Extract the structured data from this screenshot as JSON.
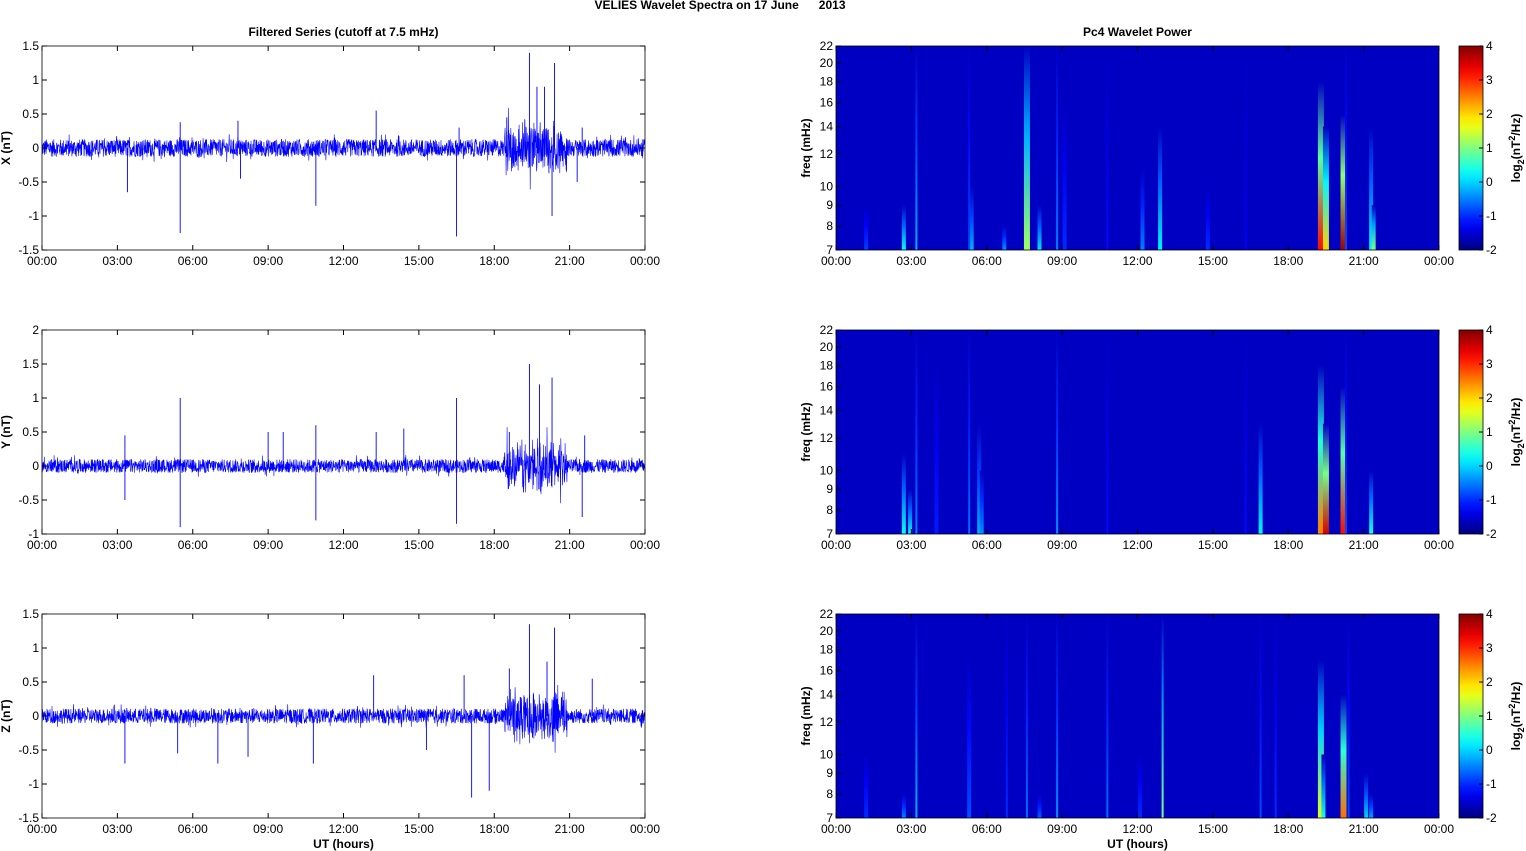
{
  "figure_title": "VELIES Wavelet Spectra on 17 June      2013",
  "chart_data": [
    {
      "type": "line",
      "panel": "X",
      "title": "Filtered Series (cutoff at 7.5 mHz)",
      "xlabel": "",
      "ylabel": "X (nT)",
      "ylim": [
        -1.5,
        1.5
      ],
      "yticks": [
        "-1.5",
        "-1",
        "-0.5",
        "0",
        "0.5",
        "1",
        "1.5"
      ],
      "xlim": [
        0,
        24
      ],
      "xticks": [
        "00:00",
        "03:00",
        "06:00",
        "09:00",
        "12:00",
        "15:00",
        "18:00",
        "21:00",
        "00:00"
      ],
      "color": "#0000ff",
      "noise_amplitude": 0.13,
      "active_interval_hours": [
        18.4,
        20.9
      ],
      "active_amplitude": 0.45,
      "spikes": [
        [
          3.4,
          -0.65
        ],
        [
          5.5,
          -1.25
        ],
        [
          5.5,
          0.38
        ],
        [
          7.8,
          0.4
        ],
        [
          7.9,
          -0.45
        ],
        [
          10.9,
          -0.85
        ],
        [
          13.3,
          0.55
        ],
        [
          16.5,
          -1.3
        ],
        [
          16.6,
          0.3
        ],
        [
          18.5,
          0.45
        ],
        [
          19.4,
          1.4
        ],
        [
          19.7,
          0.9
        ],
        [
          20.0,
          0.9
        ],
        [
          20.3,
          -1.0
        ],
        [
          20.4,
          1.25
        ],
        [
          21.3,
          -0.5
        ],
        [
          21.5,
          0.3
        ]
      ]
    },
    {
      "type": "line",
      "panel": "Y",
      "title": "",
      "xlabel": "",
      "ylabel": "Y (nT)",
      "ylim": [
        -1,
        2
      ],
      "yticks": [
        "-1",
        "-0.5",
        "0",
        "0.5",
        "1",
        "1.5",
        "2"
      ],
      "xlim": [
        0,
        24
      ],
      "xticks": [
        "00:00",
        "03:00",
        "06:00",
        "09:00",
        "12:00",
        "15:00",
        "18:00",
        "21:00",
        "00:00"
      ],
      "color": "#0000ff",
      "noise_amplitude": 0.1,
      "active_interval_hours": [
        18.4,
        20.9
      ],
      "active_amplitude": 0.45,
      "spikes": [
        [
          3.3,
          0.45
        ],
        [
          3.3,
          -0.5
        ],
        [
          5.5,
          1.0
        ],
        [
          5.5,
          -0.9
        ],
        [
          9.0,
          0.5
        ],
        [
          9.6,
          0.5
        ],
        [
          10.9,
          0.6
        ],
        [
          10.9,
          -0.8
        ],
        [
          13.3,
          0.5
        ],
        [
          14.4,
          0.55
        ],
        [
          16.5,
          1.0
        ],
        [
          16.5,
          -0.85
        ],
        [
          18.6,
          0.5
        ],
        [
          19.4,
          1.5
        ],
        [
          19.8,
          1.2
        ],
        [
          20.3,
          1.3
        ],
        [
          21.5,
          -0.75
        ],
        [
          21.6,
          0.45
        ]
      ]
    },
    {
      "type": "line",
      "panel": "Z",
      "title": "",
      "xlabel": "UT (hours)",
      "ylabel": "Z (nT)",
      "ylim": [
        -1.5,
        1.5
      ],
      "yticks": [
        "-1.5",
        "-1",
        "-0.5",
        "0",
        "0.5",
        "1",
        "1.5"
      ],
      "xlim": [
        0,
        24
      ],
      "xticks": [
        "00:00",
        "03:00",
        "06:00",
        "09:00",
        "12:00",
        "15:00",
        "18:00",
        "21:00",
        "00:00"
      ],
      "color": "#0000ff",
      "noise_amplitude": 0.11,
      "active_interval_hours": [
        18.4,
        20.9
      ],
      "active_amplitude": 0.45,
      "spikes": [
        [
          3.3,
          -0.7
        ],
        [
          5.4,
          -0.55
        ],
        [
          7.0,
          -0.7
        ],
        [
          8.2,
          -0.6
        ],
        [
          10.8,
          -0.7
        ],
        [
          13.2,
          0.6
        ],
        [
          15.3,
          -0.5
        ],
        [
          16.8,
          0.6
        ],
        [
          17.1,
          -1.2
        ],
        [
          17.8,
          -1.1
        ],
        [
          18.6,
          0.7
        ],
        [
          19.4,
          1.35
        ],
        [
          20.1,
          0.8
        ],
        [
          20.4,
          1.3
        ],
        [
          21.9,
          0.55
        ]
      ]
    },
    {
      "type": "heatmap",
      "panel": "X",
      "title": "Pc4 Wavelet Power",
      "xlabel": "",
      "ylabel": "freq (mHz)",
      "ylim": [
        7,
        22
      ],
      "yscale": "log",
      "yticks": [
        "7",
        "8",
        "9",
        "10",
        "12",
        "14",
        "16",
        "18",
        "20",
        "22"
      ],
      "xlim": [
        0,
        24
      ],
      "xticks": [
        "00:00",
        "03:00",
        "06:00",
        "09:00",
        "12:00",
        "15:00",
        "18:00",
        "21:00",
        "00:00"
      ],
      "colorbar": {
        "label": "log2(nT^2/Hz)",
        "label_main": "log",
        "label_sub": "2",
        "label_rest": "(nT",
        "label_sup": "2",
        "label_end": "/Hz)",
        "range": [
          -2,
          4
        ],
        "ticks": [
          "-2",
          "-1",
          "0",
          "1",
          "2",
          "3",
          "4"
        ]
      },
      "background_power": -1.6,
      "events": [
        [
          1.2,
          9,
          -0.9
        ],
        [
          2.7,
          9,
          0.3
        ],
        [
          3.2,
          22,
          -0.2
        ],
        [
          5.4,
          10,
          -0.2
        ],
        [
          5.3,
          22,
          -0.8
        ],
        [
          6.7,
          8,
          -0.4
        ],
        [
          7.6,
          22,
          1.2
        ],
        [
          8.1,
          9,
          0.1
        ],
        [
          8.8,
          22,
          -0.5
        ],
        [
          9.1,
          16,
          -1.0
        ],
        [
          10.8,
          22,
          -1.2
        ],
        [
          12.2,
          11,
          -0.5
        ],
        [
          12.9,
          14,
          0.2
        ],
        [
          14.8,
          10,
          -1.0
        ],
        [
          16.3,
          22,
          -1.3
        ],
        [
          19.3,
          18,
          3.2
        ],
        [
          19.5,
          14,
          2.0
        ],
        [
          20.2,
          15,
          3.8
        ],
        [
          20.3,
          22,
          -0.8
        ],
        [
          21.3,
          14,
          0.2
        ],
        [
          21.4,
          9,
          1.0
        ]
      ]
    },
    {
      "type": "heatmap",
      "panel": "Y",
      "title": "",
      "xlabel": "",
      "ylabel": "freq (mHz)",
      "ylim": [
        7,
        22
      ],
      "yscale": "log",
      "yticks": [
        "7",
        "8",
        "9",
        "10",
        "12",
        "14",
        "16",
        "18",
        "20",
        "22"
      ],
      "xlim": [
        0,
        24
      ],
      "xticks": [
        "00:00",
        "03:00",
        "06:00",
        "09:00",
        "12:00",
        "15:00",
        "18:00",
        "21:00",
        "00:00"
      ],
      "colorbar": {
        "label": "log2(nT^2/Hz)",
        "label_main": "log",
        "label_sub": "2",
        "label_rest": "(nT",
        "label_sup": "2",
        "label_end": "/Hz)",
        "range": [
          -2,
          4
        ],
        "ticks": [
          "-2",
          "-1",
          "0",
          "1",
          "2",
          "3",
          "4"
        ]
      },
      "background_power": -1.6,
      "events": [
        [
          2.7,
          11,
          0.3
        ],
        [
          2.95,
          9,
          0.2
        ],
        [
          3.2,
          22,
          -0.5
        ],
        [
          4.0,
          18,
          -1.1
        ],
        [
          5.3,
          22,
          -0.6
        ],
        [
          5.7,
          13,
          -0.2
        ],
        [
          5.8,
          10,
          -0.4
        ],
        [
          8.8,
          22,
          -0.4
        ],
        [
          10.8,
          22,
          -1.2
        ],
        [
          16.3,
          22,
          -1.2
        ],
        [
          16.9,
          13,
          0.2
        ],
        [
          19.3,
          18,
          2.5
        ],
        [
          19.5,
          13,
          3.5
        ],
        [
          20.2,
          16,
          3.2
        ],
        [
          20.3,
          22,
          -0.8
        ],
        [
          21.3,
          10,
          0.4
        ]
      ]
    },
    {
      "type": "heatmap",
      "panel": "Z",
      "title": "",
      "xlabel": "UT (hours)",
      "ylabel": "freq (mHz)",
      "ylim": [
        7,
        22
      ],
      "yscale": "log",
      "yticks": [
        "7",
        "8",
        "9",
        "10",
        "12",
        "14",
        "16",
        "18",
        "20",
        "22"
      ],
      "xlim": [
        0,
        24
      ],
      "xticks": [
        "00:00",
        "03:00",
        "06:00",
        "09:00",
        "12:00",
        "15:00",
        "18:00",
        "21:00",
        "00:00"
      ],
      "colorbar": {
        "label": "log2(nT^2/Hz)",
        "label_main": "log",
        "label_sub": "2",
        "label_rest": "(nT",
        "label_sup": "2",
        "label_end": "/Hz)",
        "range": [
          -2,
          4
        ],
        "ticks": [
          "-2",
          "-1",
          "0",
          "1",
          "2",
          "3",
          "4"
        ]
      },
      "background_power": -1.6,
      "events": [
        [
          1.2,
          10,
          -1.0
        ],
        [
          2.7,
          8,
          -0.5
        ],
        [
          3.2,
          22,
          -0.2
        ],
        [
          5.3,
          17,
          -0.8
        ],
        [
          6.8,
          22,
          -1.0
        ],
        [
          7.6,
          22,
          -0.6
        ],
        [
          8.1,
          8,
          -0.7
        ],
        [
          8.8,
          22,
          -0.4
        ],
        [
          10.8,
          22,
          -0.6
        ],
        [
          12.1,
          10,
          -1.0
        ],
        [
          13.0,
          22,
          1.0
        ],
        [
          16.9,
          22,
          -0.8
        ],
        [
          17.5,
          22,
          -1.0
        ],
        [
          19.3,
          17,
          1.6
        ],
        [
          19.4,
          10,
          0.4
        ],
        [
          20.2,
          14,
          2.6
        ],
        [
          20.4,
          22,
          -0.8
        ],
        [
          21.1,
          9,
          0.0
        ],
        [
          21.3,
          8,
          -0.3
        ]
      ]
    }
  ]
}
